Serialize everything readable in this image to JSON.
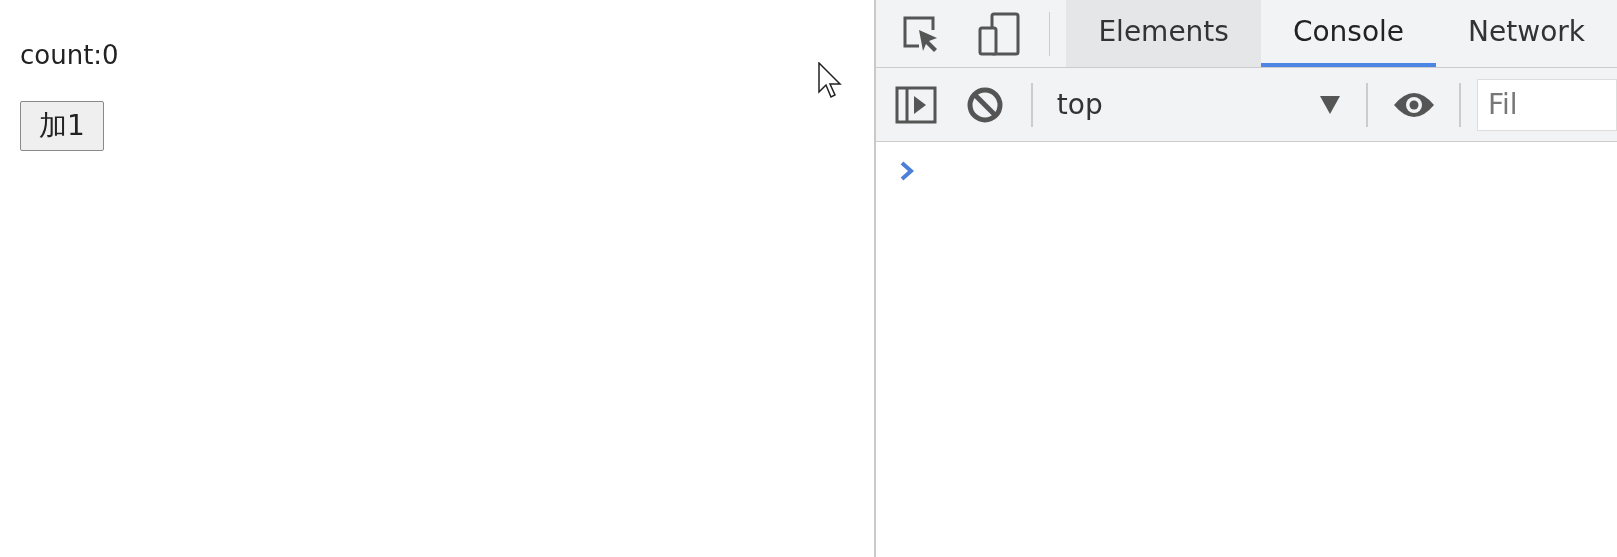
{
  "page": {
    "count_label": "count:0",
    "button": "加1"
  },
  "devtools": {
    "tabs": [
      {
        "label": "Elements",
        "selected": false,
        "hovered": true
      },
      {
        "label": "Console",
        "selected": true,
        "hovered": false
      },
      {
        "label": "Network",
        "selected": false,
        "hovered": false
      }
    ],
    "context": "top",
    "filter": {
      "placeholder": "Fil"
    }
  }
}
